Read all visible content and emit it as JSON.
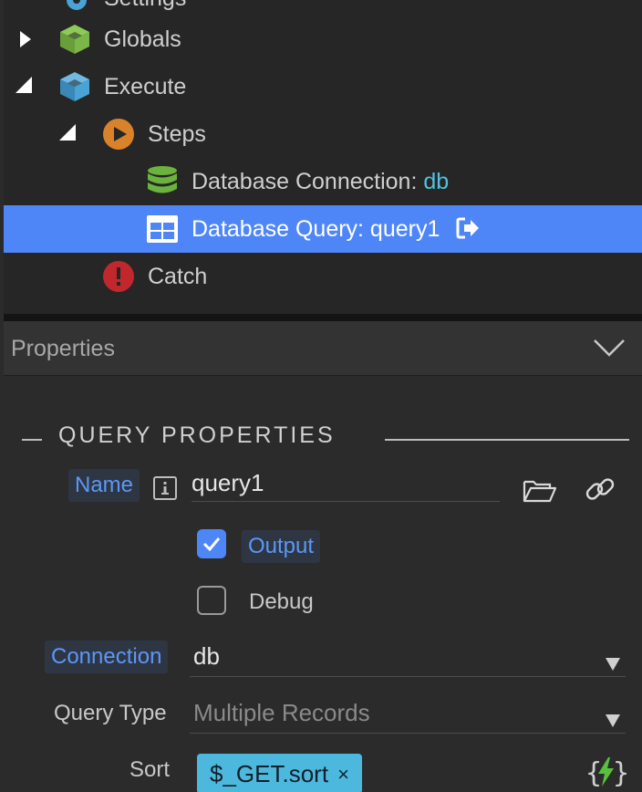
{
  "tree": {
    "items": [
      {
        "label": "Settings",
        "expanded": true
      },
      {
        "label": "Globals",
        "expanded": false
      },
      {
        "label": "Execute",
        "expanded": true
      },
      {
        "label": "Steps",
        "expanded": true
      },
      {
        "label": "Database Connection: ",
        "value": "db"
      },
      {
        "label": "Database Query: query1",
        "selected": true
      },
      {
        "label": "Catch"
      }
    ]
  },
  "properties": {
    "title": "Properties"
  },
  "section": {
    "title": "QUERY PROPERTIES"
  },
  "fields": {
    "name": {
      "label": "Name",
      "value": "query1"
    },
    "output": {
      "label": "Output",
      "checked": true
    },
    "debug": {
      "label": "Debug",
      "checked": false
    },
    "connection": {
      "label": "Connection",
      "value": "db"
    },
    "query_type": {
      "label": "Query Type",
      "value": "Multiple Records"
    },
    "sort": {
      "label": "Sort",
      "tag": "$_GET.sort",
      "remove": "×"
    }
  },
  "colors": {
    "selection": "#4f86f7",
    "accent_blue": "#5d97f5",
    "db_accent": "#4fc3e0",
    "globals_icon": "#7ab648",
    "execute_icon": "#4aa3d6",
    "steps_icon": "#d9822b",
    "catch_icon": "#c0282d",
    "db_icon": "#6bb33d",
    "sort_tag": "#4db8dd",
    "dynamic_icon": "#58c13c"
  },
  "icons": {
    "settings": "gear-icon",
    "globals": "cube-icon",
    "execute": "cube-icon",
    "steps": "play-icon",
    "db_connection": "database-icon",
    "db_query": "table-icon",
    "output_arrow": "output-arrow-icon",
    "catch": "exclamation-icon",
    "folder": "folder-open-icon",
    "link": "link-icon",
    "dynamic": "lightning-icon"
  }
}
